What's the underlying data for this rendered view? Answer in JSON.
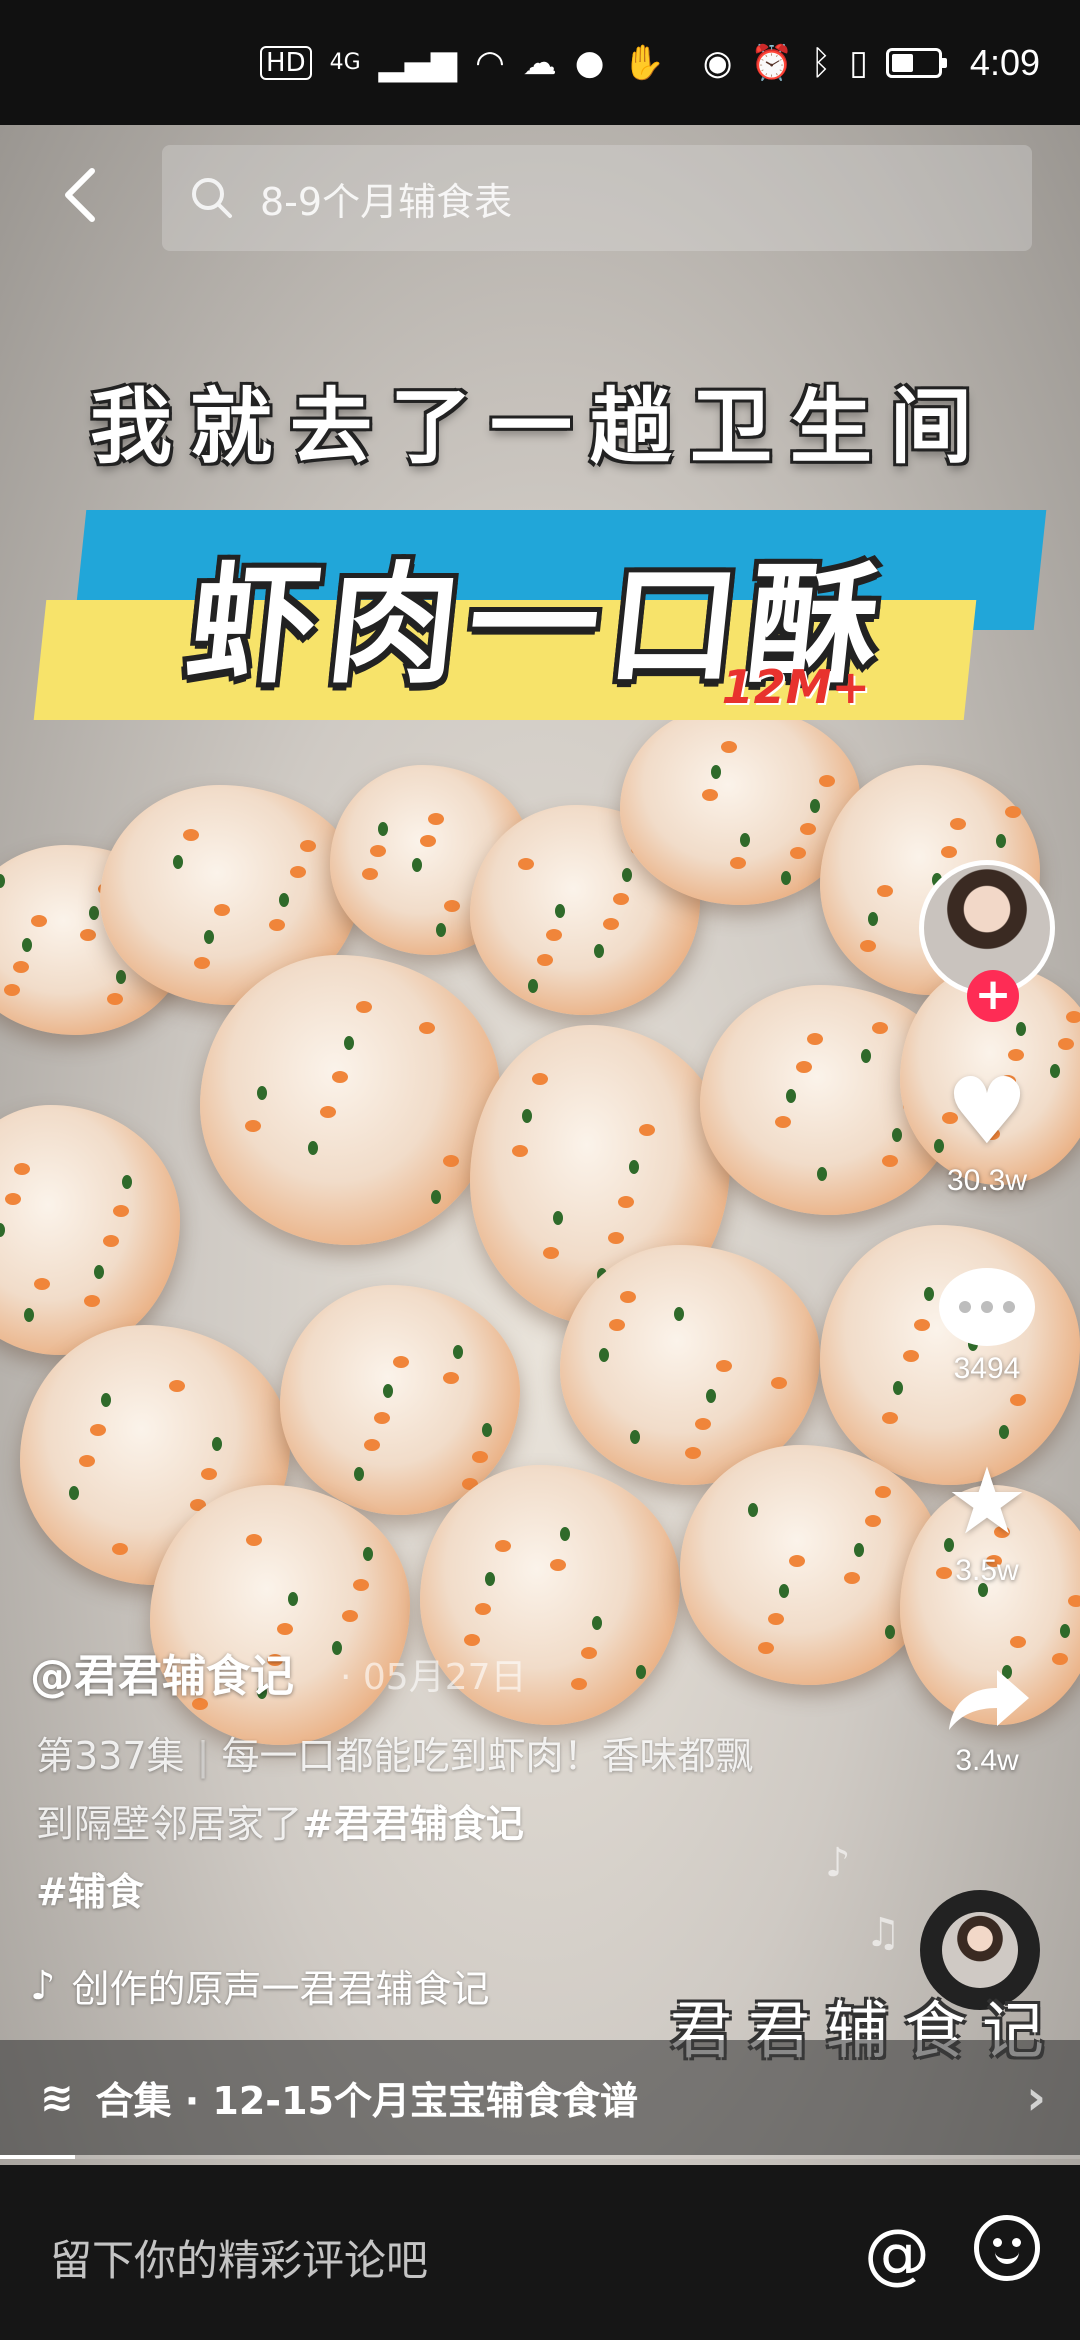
{
  "status_bar": {
    "network_badges": [
      "HD",
      "4G"
    ],
    "time": "4:09"
  },
  "search": {
    "back_icon": "chevron-left-icon",
    "placeholder": "8-9个月辅食表"
  },
  "video_overlay": {
    "caption_top": "我就去了一趟卫生间",
    "title_banner": "虾肉一口酥",
    "tag": "12M+",
    "watermark": "君君辅食记"
  },
  "side_actions": {
    "likes": "30.3w",
    "comments": "3494",
    "favorites": "3.5w",
    "shares": "3.4w"
  },
  "post": {
    "author": "@君君辅食记",
    "date": "· 05月27日",
    "episode": "第337集",
    "desc_text": "每一口都能吃到虾肉！香味都飘到隔壁邻居家了",
    "hashtags": [
      "#君君辅食记",
      "#辅食"
    ],
    "music": "创作的原声一君君辅食记"
  },
  "collection": {
    "label": "合集 · 12-15个月宝宝辅食食谱"
  },
  "comment_bar": {
    "placeholder": "留下你的精彩评论吧",
    "at_label": "@"
  },
  "colors": {
    "follow_red": "#fe2c55",
    "banner_blue": "#21a6d9",
    "banner_yellow": "#f7e36a",
    "tag_red": "#e8322e"
  }
}
